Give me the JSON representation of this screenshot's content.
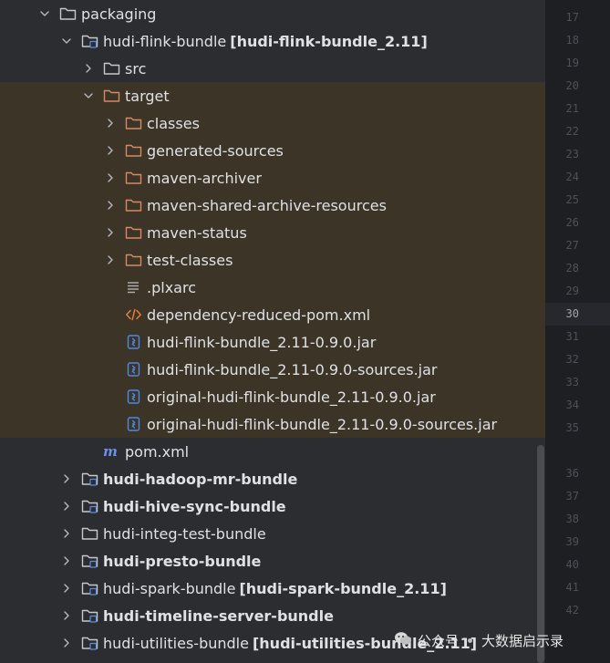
{
  "colors": {
    "panel_bg": "#2b2d30",
    "excluded_bg": "#3c3427",
    "folder_excluded": "#d58a65",
    "folder_normal": "#c6c8cc",
    "jar_icon": "#4d8ae6",
    "xml_icon": "#e37e3d",
    "maven_icon": "#6f8fe8",
    "gutter_bg": "#1e1f22"
  },
  "tree": [
    {
      "label": "packaging",
      "suffix": "",
      "level": 1,
      "chevron": "down",
      "icon": "folder",
      "bold": false,
      "excluded": false
    },
    {
      "label": "hudi-flink-bundle",
      "suffix": "[hudi-flink-bundle_2.11]",
      "level": 2,
      "chevron": "down",
      "icon": "module-folder",
      "bold": false,
      "excluded": false
    },
    {
      "label": "src",
      "suffix": "",
      "level": 3,
      "chevron": "right",
      "icon": "folder",
      "bold": false,
      "excluded": false
    },
    {
      "label": "target",
      "suffix": "",
      "level": 3,
      "chevron": "down",
      "icon": "folder-excluded",
      "bold": false,
      "excluded": true
    },
    {
      "label": "classes",
      "suffix": "",
      "level": 4,
      "chevron": "right",
      "icon": "folder-excluded",
      "bold": false,
      "excluded": true
    },
    {
      "label": "generated-sources",
      "suffix": "",
      "level": 4,
      "chevron": "right",
      "icon": "folder-excluded",
      "bold": false,
      "excluded": true
    },
    {
      "label": "maven-archiver",
      "suffix": "",
      "level": 4,
      "chevron": "right",
      "icon": "folder-excluded",
      "bold": false,
      "excluded": true
    },
    {
      "label": "maven-shared-archive-resources",
      "suffix": "",
      "level": 4,
      "chevron": "right",
      "icon": "folder-excluded",
      "bold": false,
      "excluded": true
    },
    {
      "label": "maven-status",
      "suffix": "",
      "level": 4,
      "chevron": "right",
      "icon": "folder-excluded",
      "bold": false,
      "excluded": true
    },
    {
      "label": "test-classes",
      "suffix": "",
      "level": 4,
      "chevron": "right",
      "icon": "folder-excluded",
      "bold": false,
      "excluded": true
    },
    {
      "label": ".plxarc",
      "suffix": "",
      "level": 4,
      "chevron": "none",
      "icon": "text-file",
      "bold": false,
      "excluded": true
    },
    {
      "label": "dependency-reduced-pom.xml",
      "suffix": "",
      "level": 4,
      "chevron": "none",
      "icon": "xml-file",
      "bold": false,
      "excluded": true
    },
    {
      "label": "hudi-flink-bundle_2.11-0.9.0.jar",
      "suffix": "",
      "level": 4,
      "chevron": "none",
      "icon": "jar-file",
      "bold": false,
      "excluded": true
    },
    {
      "label": "hudi-flink-bundle_2.11-0.9.0-sources.jar",
      "suffix": "",
      "level": 4,
      "chevron": "none",
      "icon": "jar-file",
      "bold": false,
      "excluded": true
    },
    {
      "label": "original-hudi-flink-bundle_2.11-0.9.0.jar",
      "suffix": "",
      "level": 4,
      "chevron": "none",
      "icon": "jar-file",
      "bold": false,
      "excluded": true
    },
    {
      "label": "original-hudi-flink-bundle_2.11-0.9.0-sources.jar",
      "suffix": "",
      "level": 4,
      "chevron": "none",
      "icon": "jar-file",
      "bold": false,
      "excluded": true
    },
    {
      "label": "pom.xml",
      "suffix": "",
      "level": 3,
      "chevron": "none",
      "icon": "maven-file",
      "bold": false,
      "excluded": false
    },
    {
      "label": "hudi-hadoop-mr-bundle",
      "suffix": "",
      "level": 2,
      "chevron": "right",
      "icon": "module-folder",
      "bold": true,
      "excluded": false
    },
    {
      "label": "hudi-hive-sync-bundle",
      "suffix": "",
      "level": 2,
      "chevron": "right",
      "icon": "module-folder",
      "bold": true,
      "excluded": false
    },
    {
      "label": "hudi-integ-test-bundle",
      "suffix": "",
      "level": 2,
      "chevron": "right",
      "icon": "folder",
      "bold": false,
      "excluded": false
    },
    {
      "label": "hudi-presto-bundle",
      "suffix": "",
      "level": 2,
      "chevron": "right",
      "icon": "module-folder",
      "bold": true,
      "excluded": false
    },
    {
      "label": "hudi-spark-bundle",
      "suffix": "[hudi-spark-bundle_2.11]",
      "level": 2,
      "chevron": "right",
      "icon": "module-folder",
      "bold": false,
      "excluded": false
    },
    {
      "label": "hudi-timeline-server-bundle",
      "suffix": "",
      "level": 2,
      "chevron": "right",
      "icon": "module-folder",
      "bold": true,
      "excluded": false
    },
    {
      "label": "hudi-utilities-bundle",
      "suffix": "[hudi-utilities-bundle_2.11]",
      "level": 2,
      "chevron": "right",
      "icon": "module-folder",
      "bold": false,
      "excluded": false
    }
  ],
  "gutter": {
    "active_line": "30",
    "lines": [
      "17",
      "18",
      "19",
      "20",
      "21",
      "22",
      "23",
      "24",
      "25",
      "26",
      "27",
      "28",
      "29",
      "30",
      "31",
      "32",
      "33",
      "34",
      "35",
      "",
      "36",
      "37",
      "38",
      "39",
      "40",
      "41",
      "42"
    ]
  },
  "watermark": {
    "left": "公众号",
    "right": "大数据启示录"
  }
}
